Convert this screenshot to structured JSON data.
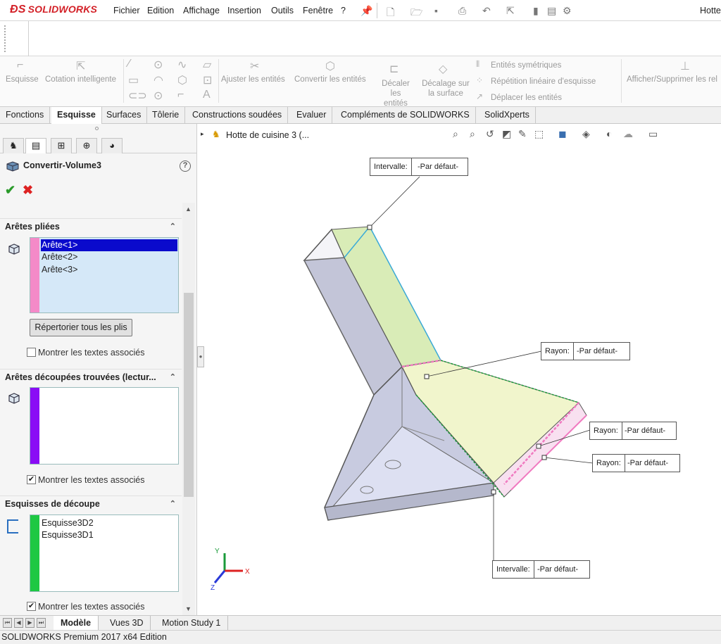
{
  "app": {
    "logo_text": "SOLIDWORKS",
    "window_title": "Hotte"
  },
  "menu": [
    "Fichier",
    "Edition",
    "Affichage",
    "Insertion",
    "Outils",
    "Fenêtre",
    "?"
  ],
  "ribbon": {
    "esquisse": "Esquisse",
    "cotation": "Cotation intelligente",
    "ajuster": "Ajuster les entités",
    "convertir": "Convertir les entités",
    "decaler1": "Décaler les",
    "decaler2": "entités",
    "decalage1": "Décalage sur",
    "decalage2": "la surface",
    "symetriques": "Entités symétriques",
    "repetition": "Répétition linéaire d'esquisse",
    "deplacer": "Déplacer les entités",
    "afficher": "Afficher/Supprimer les rel"
  },
  "tabs": [
    "Fonctions",
    "Esquisse",
    "Surfaces",
    "Tôlerie",
    "Constructions soudées",
    "Evaluer",
    "Compléments de SOLIDWORKS",
    "SolidXperts"
  ],
  "active_tab": "Esquisse",
  "panel": {
    "title": "Convertir-Volume3",
    "sections": {
      "bent_edges": {
        "header": "Arêtes pliées",
        "items": [
          "Arête<1>",
          "Arête<2>",
          "Arête<3>"
        ],
        "button": "Répertorier tous les plis",
        "checkbox_label": "Montrer les textes associés",
        "checked": false,
        "color": "#f48ac8"
      },
      "cut_edges": {
        "header": "Arêtes découpées trouvées (lectur...",
        "items": [],
        "checkbox_label": "Montrer les textes associés",
        "checked": true,
        "color": "#8a0cf5"
      },
      "cut_sketches": {
        "header": "Esquisses de découpe",
        "items": [
          "Esquisse3D2",
          "Esquisse3D1"
        ],
        "checkbox_label": "Montrer les textes associés",
        "checked": true,
        "color": "#1ec843"
      }
    }
  },
  "viewport": {
    "breadcrumb": "Hotte de cuisine 3  (...",
    "callouts": {
      "c1": {
        "key": "Intervalle:",
        "value": "-Par défaut-"
      },
      "c2": {
        "key": "Rayon:",
        "value": "-Par défaut-"
      },
      "c3": {
        "key": "Rayon:",
        "value": "-Par défaut-"
      },
      "c4": {
        "key": "Rayon:",
        "value": "-Par défaut-"
      },
      "c5": {
        "key": "Intervalle:",
        "value": "-Par défaut-"
      }
    },
    "triad": {
      "x": "X",
      "y": "Y",
      "z": "Z"
    }
  },
  "bottom_tabs": [
    "Modèle",
    "Vues 3D",
    "Motion Study 1"
  ],
  "status": "SOLIDWORKS Premium 2017 x64 Edition",
  "colors": {
    "accent": "#d32027",
    "pink_edge": "#f07ac0",
    "green_edge": "#1a9a3a",
    "blue_edge": "#3aaad8"
  }
}
